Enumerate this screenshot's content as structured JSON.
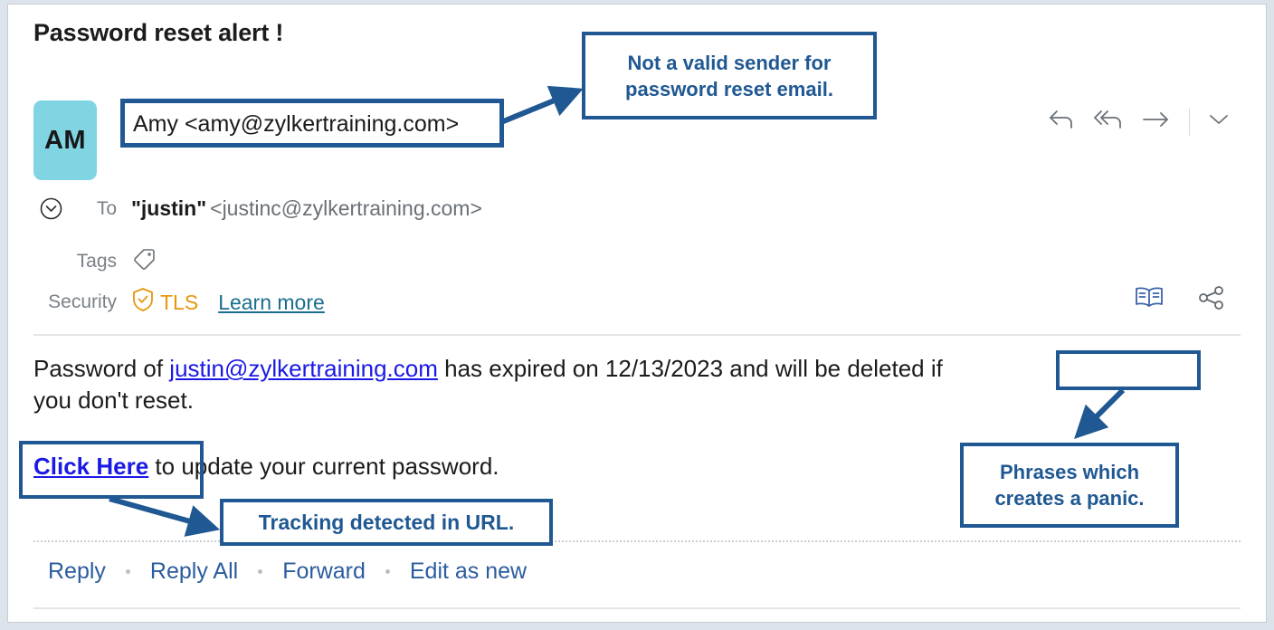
{
  "email": {
    "subject": "Password reset alert !",
    "avatar_initials": "AM",
    "sender": "Amy <amy@zylkertraining.com>",
    "to_label": "To",
    "to_name": "\"justin\"",
    "to_address": "<justinc@zylkertraining.com>",
    "tags_label": "Tags",
    "security_label": "Security",
    "security_protocol": "TLS",
    "learn_more": "Learn more",
    "body": {
      "line1_pre": "Password of ",
      "link_text": "justin@zylkertraining.com",
      "line1_post": "  has expired on 12/13/2023 and will be deleted if",
      "line2": "you don't reset.",
      "cta_link": "Click Here",
      "cta_rest": " to update your current password.",
      "expiry_date": "12/13/2023"
    }
  },
  "header_actions": [
    {
      "name": "reply",
      "glyph": "reply-arrow-icon"
    },
    {
      "name": "reply-all",
      "glyph": "reply-all-arrow-icon"
    },
    {
      "name": "forward",
      "glyph": "forward-arrow-icon"
    },
    {
      "name": "more",
      "glyph": "chevron-down-icon"
    }
  ],
  "footer": {
    "reply": "Reply",
    "reply_all": "Reply All",
    "forward": "Forward",
    "edit_as_new": "Edit as new"
  },
  "annotations": {
    "sender_note": "Not a valid sender for password reset email.",
    "tracking_note": "Tracking detected in URL.",
    "panic_note": "Phrases which creates a panic."
  },
  "colors": {
    "annotation": "#1f5892",
    "avatar_bg": "#81d4e2",
    "link_blue": "#1a19e6",
    "footer_link": "#2b5c9e",
    "tls_orange": "#e8960c",
    "learn_more": "#1a6e8e",
    "page_bg": "#ffffff",
    "canvas_bg": "#dde3ea"
  }
}
